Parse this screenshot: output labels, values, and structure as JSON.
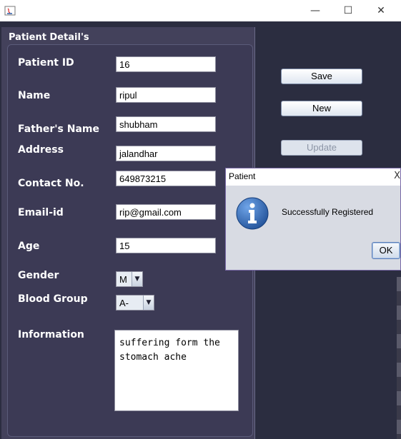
{
  "window": {
    "minimize_glyph": "—",
    "maximize_glyph": "☐",
    "close_glyph": "✕"
  },
  "panel": {
    "title": "Patient Detail's"
  },
  "form": {
    "patient_id_label": "Patient ID",
    "patient_id_value": "16",
    "name_label": "Name",
    "name_value": "ripul",
    "father_label": "Father's Name",
    "father_value": "shubham",
    "address_label": "Address",
    "address_value": "jalandhar",
    "contact_label": "Contact No.",
    "contact_value": "649873215",
    "email_label": "Email-id",
    "email_value": "rip@gmail.com",
    "age_label": "Age",
    "age_value": "15",
    "gender_label": "Gender",
    "gender_value": "M",
    "blood_label": "Blood Group",
    "blood_value": "A-",
    "info_label": "Information",
    "info_value": "suffering form the\nstomach ache"
  },
  "actions": {
    "save_label": "Save",
    "new_label": "New",
    "update_label": "Update"
  },
  "dialog": {
    "title": "Patient",
    "close_glyph": "X",
    "message": "Successfully Registered",
    "ok_label": "OK",
    "icon": "info-icon"
  },
  "colors": {
    "frame_bg": "#2b2d40",
    "panel_bg": "#43415b",
    "dialog_bg": "#d8dbe3",
    "info_blue": "#2a5ea8"
  }
}
